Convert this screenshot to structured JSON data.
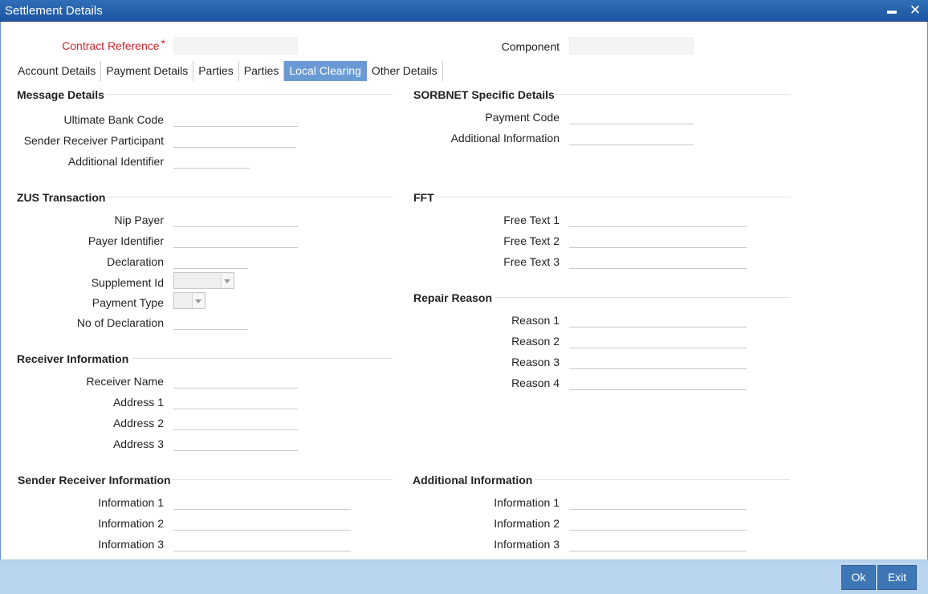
{
  "window": {
    "title": "Settlement Details",
    "minimize_glyph": "▬",
    "close_glyph": "✕"
  },
  "header": {
    "contract_reference_label": "Contract Reference",
    "required_mark": "*",
    "contract_reference_value": "",
    "component_label": "Component",
    "component_value": ""
  },
  "tabs": [
    {
      "label": "Account Details",
      "active": false
    },
    {
      "label": "Payment Details",
      "active": false
    },
    {
      "label": "Parties",
      "active": false
    },
    {
      "label": "Parties",
      "active": false
    },
    {
      "label": "Local Clearing",
      "active": true
    },
    {
      "label": "Other Details",
      "active": false
    }
  ],
  "message_details": {
    "title": "Message Details",
    "ultimate_bank_code": "Ultimate Bank Code",
    "sender_receiver_participant": "Sender Receiver Participant",
    "additional_identifier": "Additional Identifier"
  },
  "sorbnet": {
    "title": "SORBNET Specific Details",
    "payment_code": "Payment Code",
    "additional_information": "Additional Information"
  },
  "zus": {
    "title": "ZUS Transaction",
    "nip_payer": "Nip Payer",
    "payer_identifier": "Payer Identifier",
    "declaration": "Declaration",
    "supplement_id": "Supplement Id",
    "payment_type": "Payment Type",
    "no_of_declaration": "No of Declaration"
  },
  "fft": {
    "title": "FFT",
    "free_text_1": "Free Text 1",
    "free_text_2": "Free Text 2",
    "free_text_3": "Free Text 3"
  },
  "repair_reason": {
    "title": "Repair Reason",
    "reason_1": "Reason 1",
    "reason_2": "Reason 2",
    "reason_3": "Reason 3",
    "reason_4": "Reason 4"
  },
  "receiver_information": {
    "title": "Receiver Information",
    "receiver_name": "Receiver Name",
    "address_1": "Address 1",
    "address_2": "Address 2",
    "address_3": "Address 3"
  },
  "sender_receiver_information": {
    "title": "Sender Receiver Information",
    "information_1": "Information 1",
    "information_2": "Information 2",
    "information_3": "Information 3"
  },
  "additional_information": {
    "title": "Additional Information",
    "information_1": "Information 1",
    "information_2": "Information 2",
    "information_3": "Information 3"
  },
  "footer": {
    "ok_label": "Ok",
    "exit_label": "Exit"
  },
  "colors": {
    "titlebar": "#2f6fb8",
    "active_tab": "#6a9ad4",
    "footer": "#b9d4ee",
    "button": "#3e76b6",
    "required": "#d8202a"
  }
}
